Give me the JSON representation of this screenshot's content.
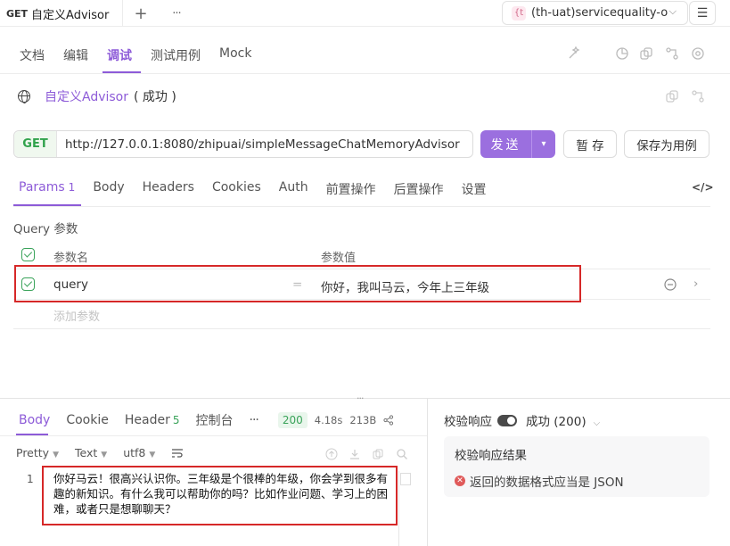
{
  "tabbar": {
    "method": "GET",
    "title": "自定义Advisor",
    "add_icon": "+",
    "more_icon": "···",
    "env_badge": "{t",
    "env_name": "(th-uat)servicequality-o",
    "env_chevron": "⌵",
    "menu_icon": "☰"
  },
  "subtabs": [
    "文档",
    "编辑",
    "调试",
    "测试用例",
    "Mock"
  ],
  "request": {
    "name": "自定义Advisor",
    "status": "( 成功 )",
    "method": "GET",
    "url": "http://127.0.0.1:8080/zhipuai/simpleMessageChatMemoryAdvisor",
    "send_label": "发送",
    "save_label": "暂 存",
    "save_case_label": "保存为用例"
  },
  "param_tabs": {
    "items": [
      "Params",
      "Body",
      "Headers",
      "Cookies",
      "Auth",
      "前置操作",
      "后置操作",
      "设置"
    ],
    "params_count": "1",
    "code_icon": "</>"
  },
  "query": {
    "section_label": "Query 参数",
    "col_name": "参数名",
    "col_value": "参数值",
    "row_name": "query",
    "row_eq": "=",
    "row_value": "你好，我叫马云，今年上三年级",
    "add_placeholder": "添加参数"
  },
  "response": {
    "tabs": [
      "Body",
      "Cookie",
      "Header",
      "控制台"
    ],
    "header_count": "5",
    "more": "···",
    "status_code": "200",
    "time": "4.18s",
    "size": "213B",
    "formats": [
      "Pretty",
      "Text",
      "utf8"
    ],
    "line_no": "1",
    "body": "你好马云！很高兴认识你。三年级是个很棒的年级，你会学到很多有趣的新知识。有什么我可以帮助你的吗？比如作业问题、学习上的困难，或者只是想聊聊天？"
  },
  "validation": {
    "label": "校验响应",
    "selected": "成功 (200)",
    "result_title": "校验响应结果",
    "error_text": "返回的数据格式应当是 JSON"
  },
  "colors": {
    "accent": "#8d5bd8",
    "success": "#3aa35a",
    "error": "#d62828"
  }
}
